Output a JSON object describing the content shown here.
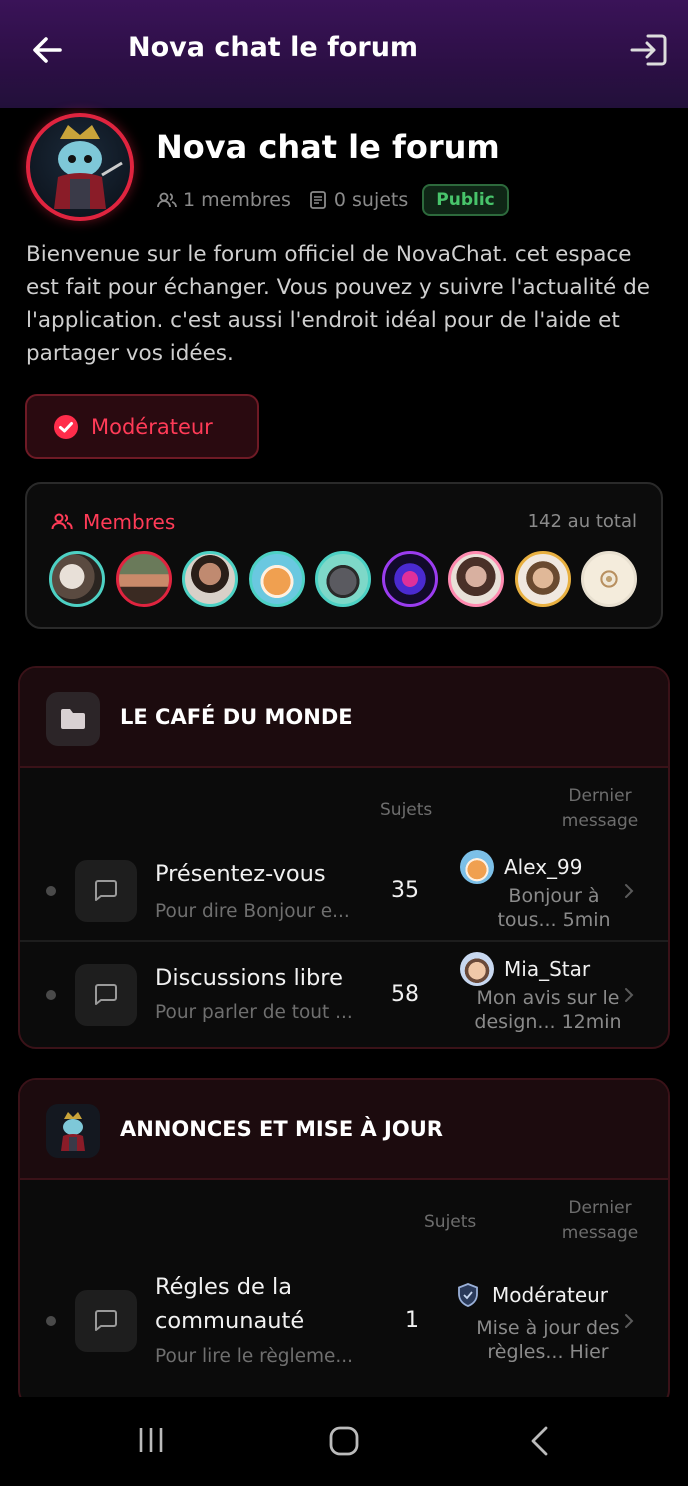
{
  "header": {
    "title": "Nova chat le forum",
    "back_icon": "arrow-left-icon",
    "exit_icon": "logout-icon"
  },
  "forum": {
    "name": "Nova chat le forum",
    "members_stat": "1 membres",
    "topics_stat": "0 sujets",
    "visibility": "Public",
    "description": "Bienvenue sur le forum officiel de NovaChat. cet espace est fait pour échanger. Vous pouvez y suivre l'actualité de l'application. c'est aussi l'endroit idéal pour de l'aide et partager vos idées."
  },
  "moderator_button": {
    "label": "Modérateur"
  },
  "members": {
    "label": "Membres",
    "total": "142 au total",
    "avatar_count": 9
  },
  "categories": [
    {
      "title": "LE CAFÉ DU MONDE",
      "col_topics": "Sujets",
      "col_last_1": "Dernier",
      "col_last_2": "message",
      "forums": [
        {
          "title": "Présentez-vous",
          "subtitle": "Pour dire Bonjour e...",
          "count": "35",
          "user": "Alex_99",
          "last_1": "Bonjour à",
          "last_2": "tous... 5min"
        },
        {
          "title": "Discussions libre",
          "subtitle": "Pour parler de tout ...",
          "count": "58",
          "user": "Mia_Star",
          "last_1": "Mon avis sur le",
          "last_2": "design... 12min"
        }
      ]
    },
    {
      "title": "ANNONCES ET MISE À JOUR",
      "col_topics": "Sujets",
      "col_last_1": "Dernier",
      "col_last_2": "message",
      "forums": [
        {
          "title_1": "Régles de la",
          "title_2": "communauté",
          "subtitle": "Pour lire le règleme...",
          "count": "1",
          "user": "Modérateur",
          "last_1": "Mise à jour des",
          "last_2": "règles... Hier"
        }
      ]
    }
  ],
  "colors": {
    "accent": "#ff3b57",
    "public_green": "#48c46b",
    "header_purple": "#3a1358"
  }
}
